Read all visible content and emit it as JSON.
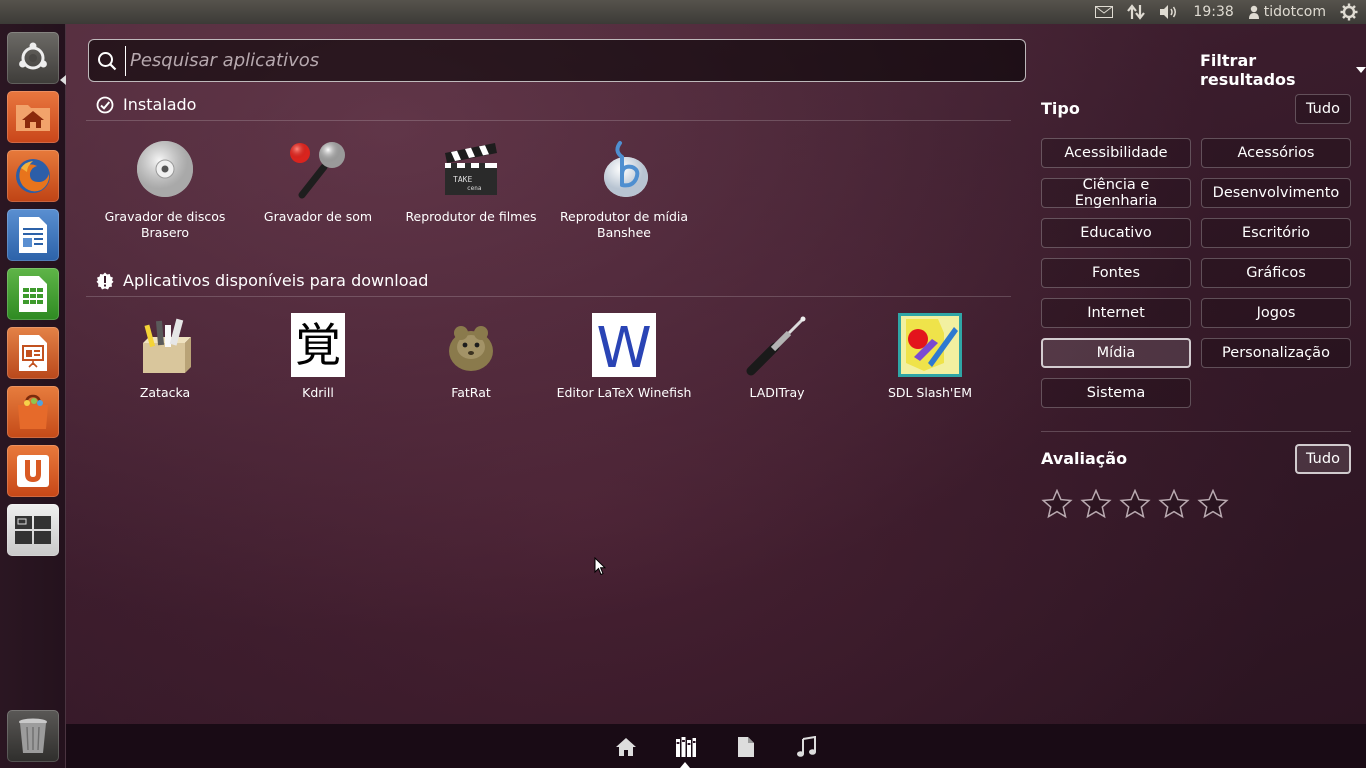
{
  "top_panel": {
    "time": "19:38",
    "user": "tidotcom",
    "icons": [
      "mail-icon",
      "network-icon",
      "volume-icon",
      "user-icon",
      "session-gear-icon"
    ]
  },
  "launcher": {
    "items": [
      "dash-home-icon",
      "files-icon",
      "firefox-icon",
      "writer-icon",
      "calc-icon",
      "impress-icon",
      "software-center-icon",
      "ubuntu-one-icon",
      "workspace-switcher-icon",
      "trash-icon"
    ]
  },
  "search": {
    "placeholder": "Pesquisar aplicativos",
    "value": ""
  },
  "installed": {
    "title": "Instalado",
    "apps": [
      {
        "label": "Gravador de discos Brasero",
        "icon": "disc-icon"
      },
      {
        "label": "Gravador de som",
        "icon": "microphone-icon"
      },
      {
        "label": "Reprodutor de filmes",
        "icon": "clapperboard-icon"
      },
      {
        "label": "Reprodutor de mídia Banshee",
        "icon": "banshee-icon"
      }
    ]
  },
  "available": {
    "title": "Aplicativos disponíveis para download",
    "apps": [
      {
        "label": "Zatacka",
        "icon": "zatacka-icon"
      },
      {
        "label": "Kdrill",
        "icon": "kdrill-icon"
      },
      {
        "label": "FatRat",
        "icon": "rat-icon"
      },
      {
        "label": "Editor LaTeX Winefish",
        "icon": "winefish-icon"
      },
      {
        "label": "LADITray",
        "icon": "jack-plug-icon"
      },
      {
        "label": "SDL Slash'EM",
        "icon": "slashem-icon"
      }
    ]
  },
  "filters": {
    "header": "Filtrar resultados",
    "type": {
      "label": "Tipo",
      "all": "Tudo",
      "options": [
        "Acessibilidade",
        "Acessórios",
        "Ciência e Engenharia",
        "Desenvolvimento",
        "Educativo",
        "Escritório",
        "Fontes",
        "Gráficos",
        "Internet",
        "Jogos",
        "Mídia",
        "Personalização",
        "Sistema"
      ],
      "selected": "Mídia"
    },
    "rating": {
      "label": "Avaliação",
      "all": "Tudo",
      "stars": 5
    }
  },
  "lenses": [
    "home-lens-icon",
    "applications-lens-icon",
    "files-lens-icon",
    "music-lens-icon"
  ],
  "colors": {
    "accent": "#e05a1e",
    "launcher_orange": "#d4562a"
  }
}
